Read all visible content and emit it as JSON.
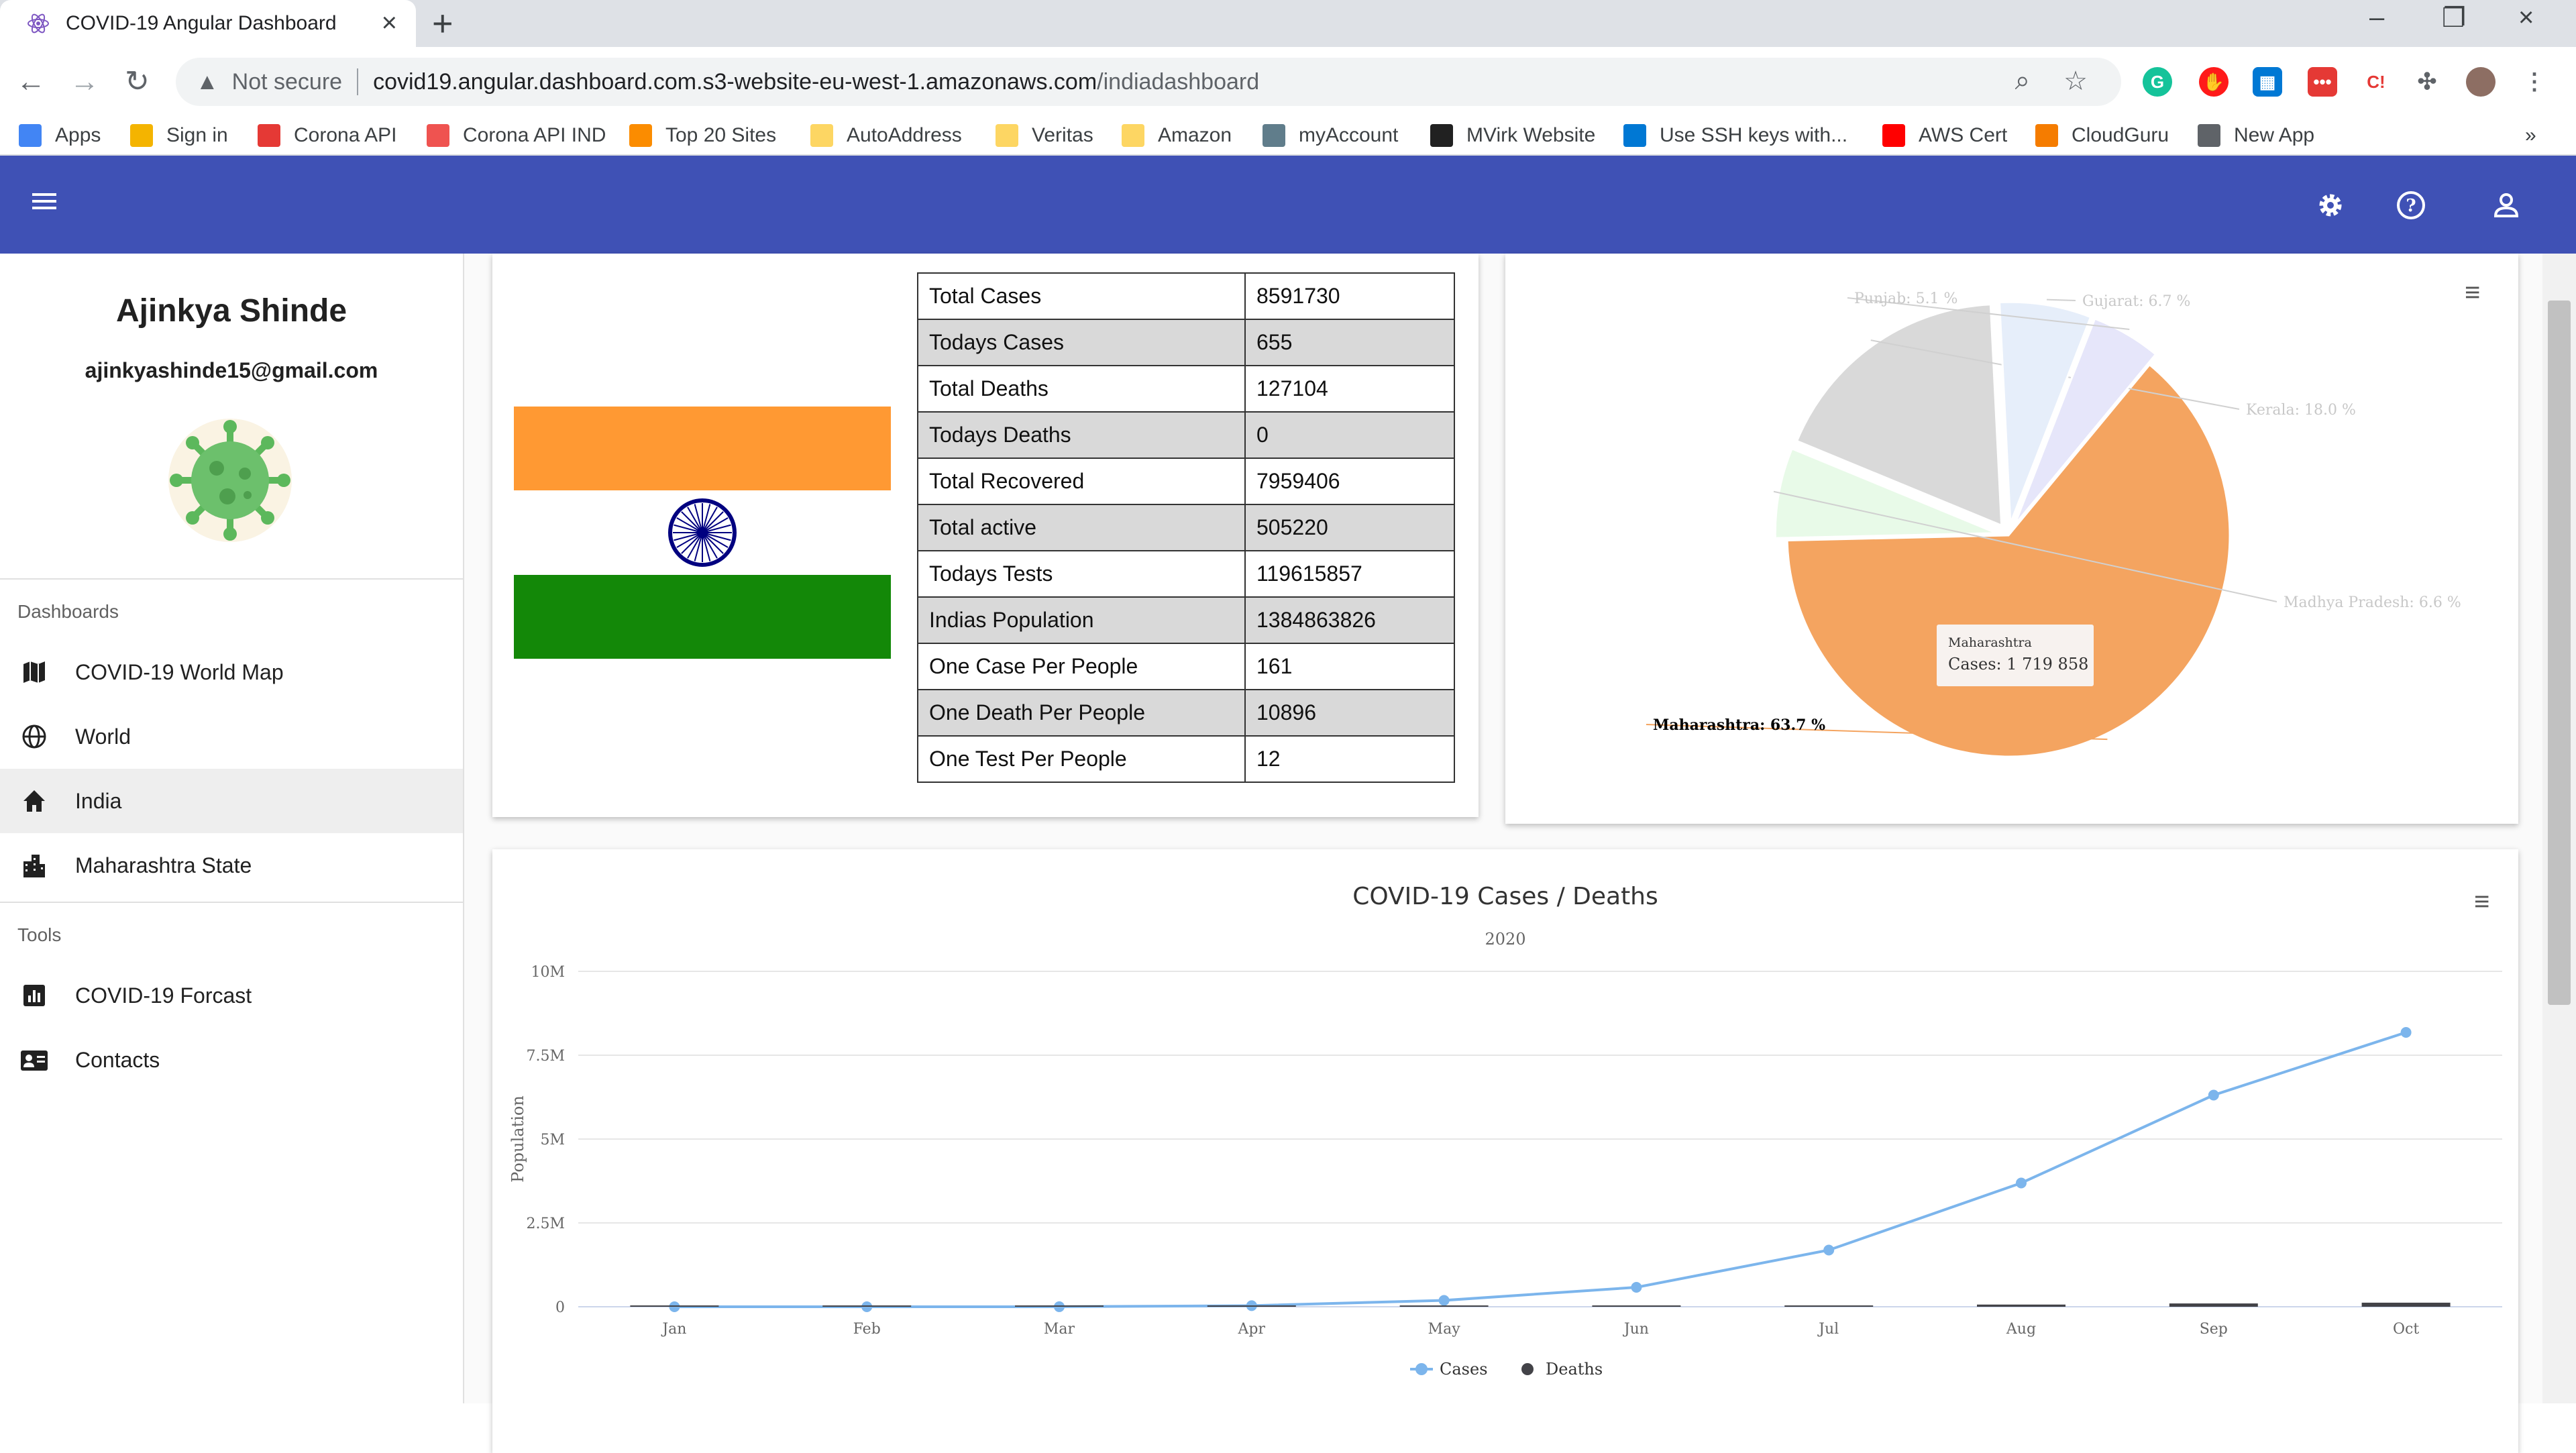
{
  "browser": {
    "tab_title": "COVID-19 Angular Dashboard",
    "not_secure": "Not secure",
    "url_host": "covid19.angular.dashboard.com.s3-website-eu-west-1.amazonaws.com",
    "url_path": "/indiadashboard",
    "bookmarks": [
      {
        "label": "Apps",
        "icon": "apps-grid-icon",
        "color": "#4285f4"
      },
      {
        "label": "Sign in",
        "icon": "box-icon",
        "color": "#f4b400"
      },
      {
        "label": "Corona API",
        "icon": "virus-icon",
        "color": "#e53935"
      },
      {
        "label": "Corona API IND",
        "icon": "api-icon",
        "color": "#ef5350"
      },
      {
        "label": "Top 20 Sites",
        "icon": "cube-icon",
        "color": "#fb8c00"
      },
      {
        "label": "AutoAddress",
        "icon": "folder-icon",
        "color": "#fdd663"
      },
      {
        "label": "Veritas",
        "icon": "folder-icon",
        "color": "#fdd663"
      },
      {
        "label": "Amazon",
        "icon": "folder-icon",
        "color": "#fdd663"
      },
      {
        "label": "myAccount",
        "icon": "antenna-icon",
        "color": "#607d8b"
      },
      {
        "label": "MVirk Website",
        "icon": "person-icon",
        "color": "#212121"
      },
      {
        "label": "Use SSH keys with...",
        "icon": "windows-icon",
        "color": "#0078d4"
      },
      {
        "label": "AWS Cert",
        "icon": "youtube-icon",
        "color": "#ff0000"
      },
      {
        "label": "CloudGuru",
        "icon": "cloud-icon",
        "color": "#f57c00"
      },
      {
        "label": "New App",
        "icon": "globe-icon",
        "color": "#5f6368"
      }
    ]
  },
  "sidebar": {
    "user_name": "Ajinkya Shinde",
    "user_email": "ajinkyashinde15@gmail.com",
    "section_dashboards": "Dashboards",
    "section_tools": "Tools",
    "items": [
      {
        "label": "COVID-19 World Map",
        "icon": "map-icon"
      },
      {
        "label": "World",
        "icon": "globe-icon"
      },
      {
        "label": "India",
        "icon": "home-icon"
      },
      {
        "label": "Maharashtra State",
        "icon": "city-icon"
      },
      {
        "label": "COVID-19 Forcast",
        "icon": "chart-icon"
      },
      {
        "label": "Contacts",
        "icon": "contact-card-icon"
      }
    ]
  },
  "stats": [
    {
      "label": "Total Cases",
      "value": "8591730"
    },
    {
      "label": "Todays Cases",
      "value": "655"
    },
    {
      "label": "Total Deaths",
      "value": "127104"
    },
    {
      "label": "Todays Deaths",
      "value": "0"
    },
    {
      "label": "Total Recovered",
      "value": "7959406"
    },
    {
      "label": "Total active",
      "value": "505220"
    },
    {
      "label": "Todays Tests",
      "value": "119615857"
    },
    {
      "label": "Indias Population",
      "value": "1384863826"
    },
    {
      "label": "One Case Per People",
      "value": "161"
    },
    {
      "label": "One Death Per People",
      "value": "10896"
    },
    {
      "label": "One Test Per People",
      "value": "12"
    }
  ],
  "colors": {
    "appbar": "#3f51b5",
    "saffron": "#ff9933",
    "green": "#138808",
    "chakra": "#000080"
  },
  "chart_data": [
    {
      "type": "pie",
      "slices": [
        {
          "name": "Maharashtra",
          "label": "Maharashtra: 63.7 %",
          "value": 63.7,
          "color": "#f4a460"
        },
        {
          "name": "Madhya Pradesh",
          "label": "Madhya Pradesh: 6.6 %",
          "value": 6.6,
          "color": "#e8fae8"
        },
        {
          "name": "Kerala",
          "label": "Kerala: 18.0 %",
          "value": 18.0,
          "color": "#d9d9d9"
        },
        {
          "name": "Gujarat",
          "label": "Gujarat: 6.7 %",
          "value": 6.7,
          "color": "#e6eefa"
        },
        {
          "name": "Punjab",
          "label": "Punjab: 5.1 %",
          "value": 5.1,
          "color": "#e6e6fa"
        }
      ],
      "tooltip": {
        "title": "Maharashtra",
        "line": "Cases: 1 719 858"
      }
    },
    {
      "type": "line",
      "title": "COVID-19 Cases / Deaths",
      "subtitle": "2020",
      "ylabel": "Population",
      "categories": [
        "Jan",
        "Feb",
        "Mar",
        "Apr",
        "May",
        "Jun",
        "Jul",
        "Aug",
        "Sep",
        "Oct"
      ],
      "yticks": [
        "0",
        "2.5M",
        "5M",
        "7.5M",
        "10M"
      ],
      "ylim": [
        0,
        10000000
      ],
      "series": [
        {
          "name": "Cases",
          "color": "#7cb5ec",
          "values": [
            1,
            3,
            1400,
            33000,
            190000,
            580000,
            1690000,
            3690000,
            6310000,
            8180000
          ]
        },
        {
          "name": "Deaths",
          "color": "#434348",
          "values": [
            0,
            0,
            30,
            1100,
            5400,
            17000,
            36500,
            65300,
            98700,
            121700
          ]
        }
      ]
    }
  ]
}
